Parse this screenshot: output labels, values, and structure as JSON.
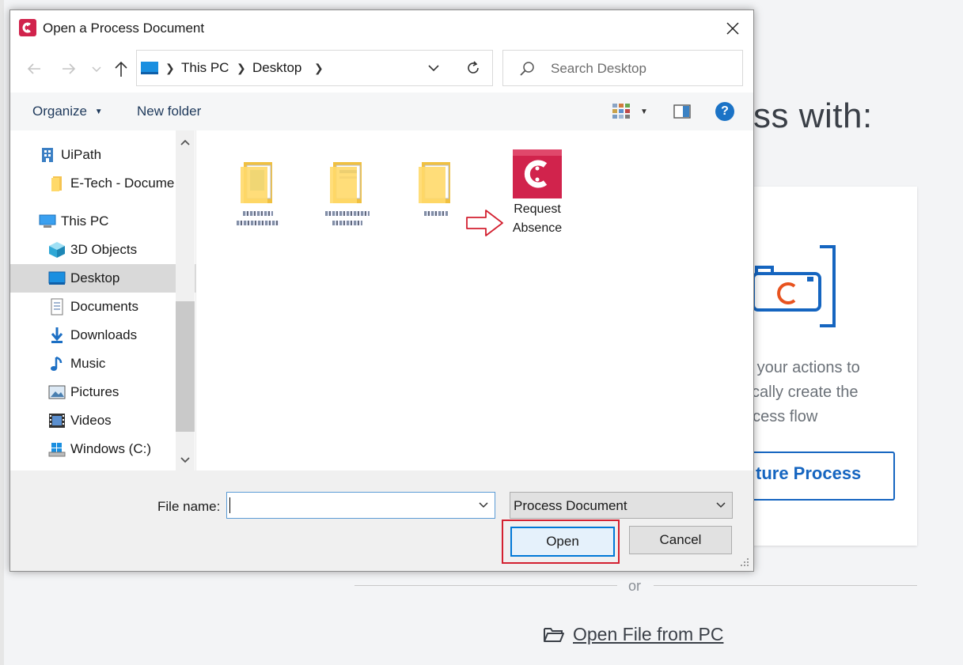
{
  "background_app": {
    "heading_fragment": "ss with:",
    "card_text_lines": [
      "e your actions to",
      "tically create the",
      "ocess flow"
    ],
    "capture_button_label": "ture Process",
    "divider_text": "or",
    "open_file_label": "Open File from PC",
    "accent_color": "#1565c0",
    "camera_accent": "#e8531f"
  },
  "dialog": {
    "title": "Open a Process Document",
    "app_icon": "uipath-logo-icon",
    "brand_color": "#d1234c",
    "address": {
      "crumbs": [
        "This PC",
        "Desktop"
      ]
    },
    "search": {
      "placeholder": "Search Desktop"
    },
    "toolbar": {
      "organize": "Organize",
      "new_folder": "New folder"
    },
    "nav": {
      "items": [
        {
          "label": "UiPath",
          "icon": "building-icon"
        },
        {
          "label": "E-Tech - Docume",
          "icon": "folder-icon"
        },
        {
          "label": "This PC",
          "icon": "pc-icon"
        },
        {
          "label": "3D Objects",
          "icon": "cube-icon"
        },
        {
          "label": "Desktop",
          "icon": "desktop-icon",
          "selected": true
        },
        {
          "label": "Documents",
          "icon": "document-icon"
        },
        {
          "label": "Downloads",
          "icon": "download-icon"
        },
        {
          "label": "Music",
          "icon": "music-icon"
        },
        {
          "label": "Pictures",
          "icon": "picture-icon"
        },
        {
          "label": "Videos",
          "icon": "video-icon"
        },
        {
          "label": "Windows (C:)",
          "icon": "drive-icon"
        }
      ]
    },
    "files": [
      {
        "type": "folder",
        "label": "",
        "obscured": true
      },
      {
        "type": "folder",
        "label": "",
        "obscured": true
      },
      {
        "type": "folder",
        "label": "",
        "obscured": true
      },
      {
        "type": "process-document",
        "label_line1": "Request",
        "label_line2": "Absence"
      }
    ],
    "footer": {
      "file_name_label": "File name:",
      "file_name_value": "",
      "file_type": "Process Document",
      "open_button": "Open",
      "cancel_button": "Cancel"
    }
  }
}
